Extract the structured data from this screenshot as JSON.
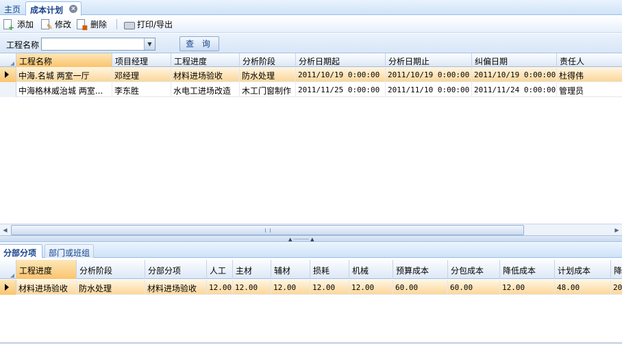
{
  "tabs": {
    "home": "主页",
    "active": "成本计划"
  },
  "toolbar": {
    "add": "添加",
    "edit": "修改",
    "delete": "删除",
    "print": "打印/导出"
  },
  "search": {
    "label": "工程名称",
    "value": "",
    "button": "查 询"
  },
  "main_grid": {
    "columns": [
      "工程名称",
      "项目经理",
      "工程进度",
      "分析阶段",
      "分析日期起",
      "分析日期止",
      "纠偏日期",
      "责任人"
    ],
    "rows": [
      [
        "中海.名城 两室一厅",
        "邓经理",
        "材料进场验收",
        "防水处理",
        "2011/10/19 0:00:00",
        "2011/10/19 0:00:00",
        "2011/10/19 0:00:00",
        "杜得伟"
      ],
      [
        "中海格林威治城 两室...",
        "李东胜",
        "水电工进场改造",
        "木工门窗制作",
        "2011/11/25 0:00:00",
        "2011/11/10 0:00:00",
        "2011/11/24 0:00:00",
        "管理员"
      ]
    ]
  },
  "bottom_tabs": {
    "active": "分部分项",
    "inactive": "部门或班组"
  },
  "detail_grid": {
    "columns": [
      "工程进度",
      "分析阶段",
      "分部分项",
      "人工",
      "主材",
      "辅材",
      "损耗",
      "机械",
      "预算成本",
      "分包成本",
      "降低成本",
      "计划成本",
      "降"
    ],
    "rows": [
      [
        "材料进场验收",
        "防水处理",
        "材料进场验收",
        "12.00",
        "12.00",
        "12.00",
        "12.00",
        "12.00",
        "60.00",
        "60.00",
        "12.00",
        "48.00",
        "20"
      ]
    ]
  }
}
